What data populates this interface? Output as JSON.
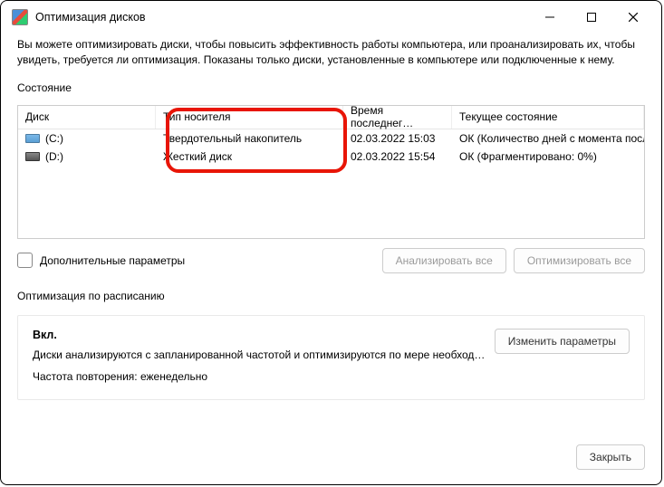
{
  "window": {
    "title": "Оптимизация дисков"
  },
  "description": "Вы можете оптимизировать диски, чтобы повысить эффективность работы  компьютера, или проанализировать их, чтобы увидеть, требуется ли оптимизация. Показаны только диски, установленные в компьютере или подключенные к нему.",
  "state_label": "Состояние",
  "columns": {
    "disk": "Диск",
    "type": "Тип носителя",
    "last": "Время последнег…",
    "status": "Текущее состояние"
  },
  "rows": [
    {
      "icon": "ssd",
      "name": "(C:)",
      "type": "Твердотельный накопитель",
      "last": "02.03.2022 15:03",
      "status": "ОК (Количество дней с момента посл…"
    },
    {
      "icon": "hdd",
      "name": "(D:)",
      "type": "Жесткий диск",
      "last": "02.03.2022 15:54",
      "status": "ОК (Фрагментировано: 0%)"
    }
  ],
  "advanced_label": "Дополнительные параметры",
  "buttons": {
    "analyze_all": "Анализировать все",
    "optimize_all": "Оптимизировать все",
    "change": "Изменить параметры",
    "close": "Закрыть"
  },
  "schedule": {
    "label": "Оптимизация по расписанию",
    "on": "Вкл.",
    "line": "Диски анализируются с запланированной частотой и оптимизируются по мере необход…",
    "freq": "Частота повторения: еженедельно"
  }
}
